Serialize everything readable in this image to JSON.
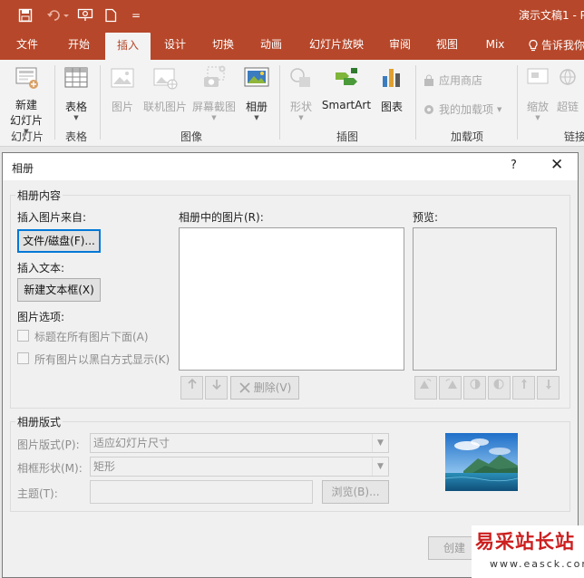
{
  "titlebar": {
    "doc_title": "演示文稿1 - P",
    "qat_customize": "="
  },
  "tabs": [
    {
      "label": "文件"
    },
    {
      "label": "开始"
    },
    {
      "label": "插入"
    },
    {
      "label": "设计"
    },
    {
      "label": "切换"
    },
    {
      "label": "动画"
    },
    {
      "label": "幻灯片放映"
    },
    {
      "label": "审阅"
    },
    {
      "label": "视图"
    },
    {
      "label": "Mix"
    },
    {
      "label": "告诉我你"
    }
  ],
  "ribbon": {
    "new_slide_l1": "新建",
    "new_slide_l2": "幻灯片",
    "table": "表格",
    "picture": "图片",
    "online_picture": "联机图片",
    "screenshot": "屏幕截图",
    "album": "相册",
    "shapes": "形状",
    "smartart": "SmartArt",
    "chart": "图表",
    "store": "应用商店",
    "my_addins": "我的加载项",
    "zoom": "缩放",
    "hyperlink": "超链",
    "groups": {
      "slides": "幻灯片",
      "tables": "表格",
      "images": "图像",
      "illustrations": "插图",
      "addins": "加载项",
      "links": "链接"
    }
  },
  "dialog": {
    "title": "相册",
    "help": "?",
    "close": "✕",
    "content_legend": "相册内容",
    "insert_from": "插入图片来自:",
    "file_disk_btn": "文件/磁盘(F)...",
    "insert_text": "插入文本:",
    "new_textbox_btn": "新建文本框(X)",
    "picture_options": "图片选项:",
    "opt_caption": "标题在所有图片下面(A)",
    "opt_bw": "所有图片以黑白方式显示(K)",
    "pictures_in_album": "相册中的图片(R):",
    "preview": "预览:",
    "delete_btn": "删除(V)",
    "layout_legend": "相册版式",
    "picture_layout_label": "图片版式(P):",
    "picture_layout_value": "适应幻灯片尺寸",
    "frame_shape_label": "相框形状(M):",
    "frame_shape_value": "矩形",
    "theme_label": "主题(T):",
    "browse_btn": "浏览(B)...",
    "create_btn": "创建"
  },
  "watermark": {
    "big": "易采站长站",
    "small": "www.easck.com"
  }
}
